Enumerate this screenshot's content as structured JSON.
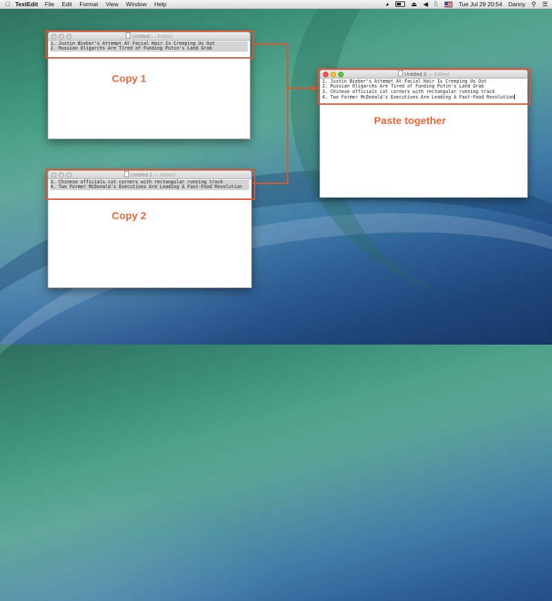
{
  "menubar": {
    "app_name": "TextEdit",
    "menus": [
      "File",
      "Edit",
      "Format",
      "View",
      "Window",
      "Help"
    ],
    "clock": "Tue Jul 29  20:54",
    "user": "Danny"
  },
  "window1": {
    "title": "Untitled",
    "edited": "— Edited",
    "lines": [
      "1. Justin Bieber's Attempt At Facial Hair Is Creeping Us Out",
      "2. Russian Oligarchs Are Tired of Funding Putin's Land Grab"
    ]
  },
  "window2": {
    "title": "Untitled 2",
    "edited": "— Edited",
    "lines": [
      "3. Chinese officials cut corners with rectangular running track",
      "4. Two Former McDonald's Executives Are Leading A Fast-Food Revolution"
    ]
  },
  "window3": {
    "title": "Untitled 3",
    "edited": "— Edited",
    "lines": [
      "1. Justin Bieber's Attempt At Facial Hair Is Creeping Us Out",
      "2. Russian Oligarchs Are Tired of Funding Putin's Land Grab",
      "3. Chinese officials cut corners with rectangular running track",
      "4. Two Former McDonald's Executives Are Leading A Fast-Food Revolution"
    ]
  },
  "annotations": {
    "copy1": "Copy 1",
    "copy2": "Copy 2",
    "paste": "Paste together",
    "color": "#e0552f"
  }
}
